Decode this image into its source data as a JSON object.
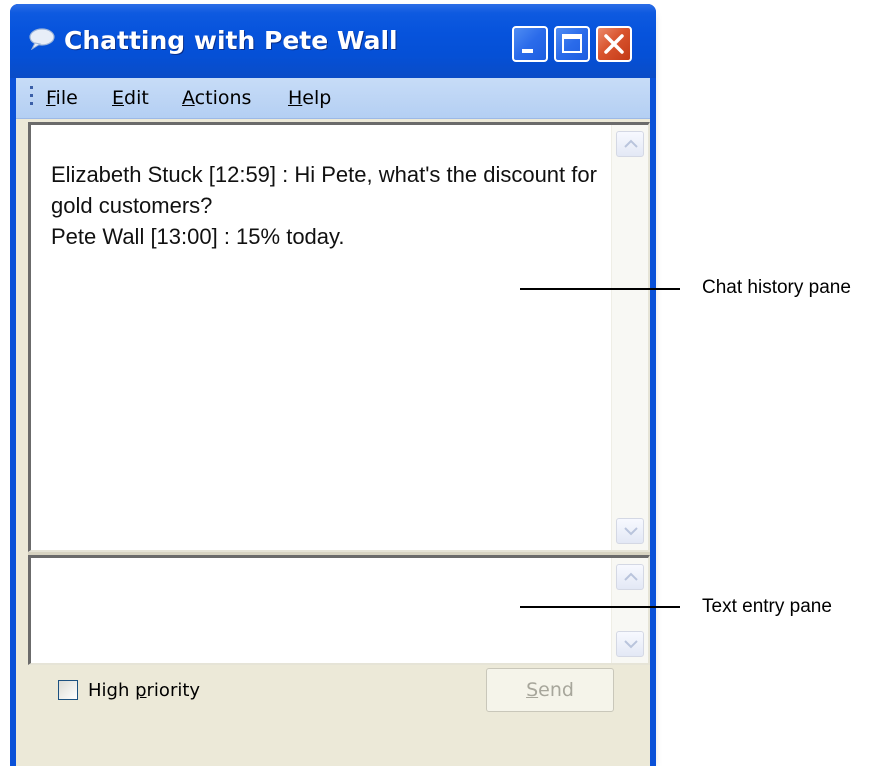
{
  "window": {
    "title": "Chatting with Pete Wall",
    "title_color": "#0653dc"
  },
  "menu": {
    "file_first": "F",
    "file_rest": "ile",
    "edit_first": "E",
    "edit_rest": "dit",
    "actions_first": "A",
    "actions_rest": "ctions",
    "help_first": "H",
    "help_rest": "elp"
  },
  "chat_history": {
    "lines": [
      "Elizabeth Stuck [12:59] : Hi Pete, what's the discount for gold customers?",
      "Pete Wall [13:00] : 15% today."
    ]
  },
  "text_entry": {
    "value": ""
  },
  "footer": {
    "priority_label_before": "High ",
    "priority_label_ul": "p",
    "priority_label_after": "riority",
    "priority_checked": false,
    "send_ul": "S",
    "send_rest": "end",
    "send_enabled": false
  },
  "callouts": {
    "history": "Chat history pane",
    "entry": "Text entry pane"
  }
}
